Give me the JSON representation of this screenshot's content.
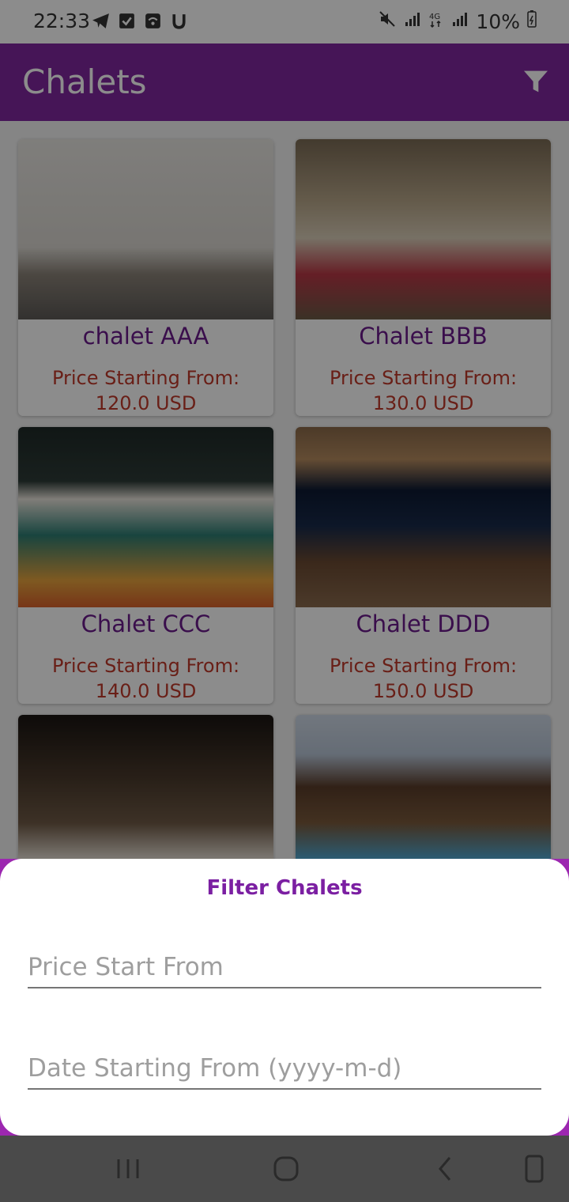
{
  "status_bar": {
    "time": "22:33",
    "battery": "10%",
    "left_icons": [
      "telegram-icon",
      "checkbox-icon",
      "wifi-calling-icon",
      "u-icon"
    ],
    "right_icons": [
      "mute-icon",
      "signal-icon",
      "4g-icon",
      "signal-icon"
    ]
  },
  "app_bar": {
    "title": "Chalets",
    "filter_icon": "filter-icon",
    "color": "#80279e"
  },
  "chalets": [
    {
      "name": "chalet AAA",
      "price_label": "Price Starting From:",
      "price": "120.0 USD"
    },
    {
      "name": "Chalet BBB",
      "price_label": "Price Starting From:",
      "price": "130.0 USD"
    },
    {
      "name": "Chalet CCC",
      "price_label": "Price Starting From:",
      "price": "140.0 USD"
    },
    {
      "name": "Chalet DDD",
      "price_label": "Price Starting From:",
      "price": "150.0 USD"
    }
  ],
  "filter_sheet": {
    "title": "Filter Chalets",
    "price_placeholder": "Price Start From",
    "date_placeholder": "Date Starting From (yyyy-m-d)"
  },
  "colors": {
    "accent": "#80279e",
    "name_text": "#6a1b8a",
    "price_text": "#c0392b"
  },
  "nav_bar": {
    "buttons": [
      "recent-apps-icon",
      "home-icon",
      "back-icon",
      "keyboard-icon"
    ]
  }
}
